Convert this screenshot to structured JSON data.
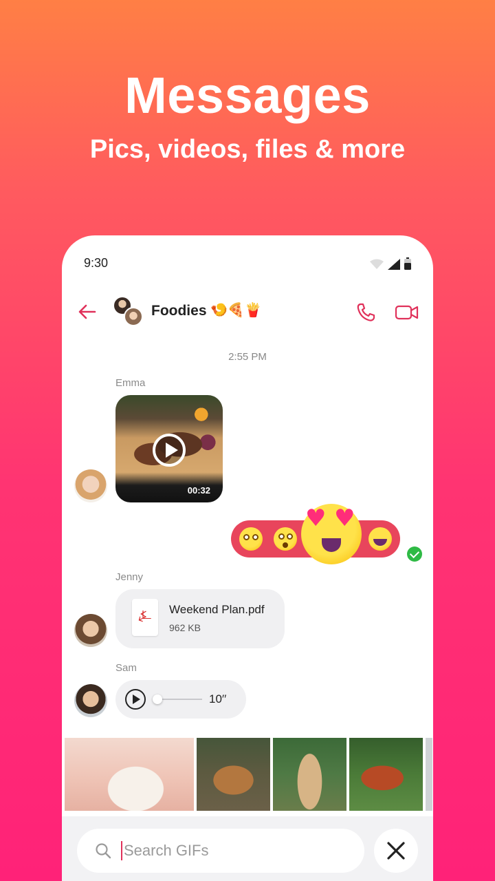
{
  "hero": {
    "title": "Messages",
    "subtitle": "Pics, videos, files & more"
  },
  "status_bar": {
    "time": "9:30"
  },
  "chat": {
    "group_name": "Foodies",
    "group_emoji": "🍤🍕🍟",
    "timestamp": "2:55 PM"
  },
  "messages": [
    {
      "sender": "Emma",
      "type": "video",
      "duration": "00:32"
    },
    {
      "sender": "me",
      "type": "reactions",
      "emojis": [
        "😳",
        "😳",
        "😍",
        "😄"
      ],
      "read": true
    },
    {
      "sender": "Jenny",
      "type": "file",
      "file_name": "Weekend Plan.pdf",
      "file_size": "962 KB"
    },
    {
      "sender": "Sam",
      "type": "voice",
      "duration": "10′′"
    }
  ],
  "gif_search": {
    "placeholder": "Search GIFs",
    "value": ""
  },
  "colors": {
    "accent": "#e0315a",
    "reaction_bar": "#e8455c",
    "read_check": "#2fba45",
    "gradient_top": "#ff7f45",
    "gradient_bottom": "#ff2278"
  },
  "icons": {
    "back": "arrow-left-icon",
    "call": "phone-icon",
    "video_call": "video-camera-icon",
    "search": "search-icon",
    "close": "close-icon",
    "file": "pdf-icon",
    "play": "play-icon"
  }
}
